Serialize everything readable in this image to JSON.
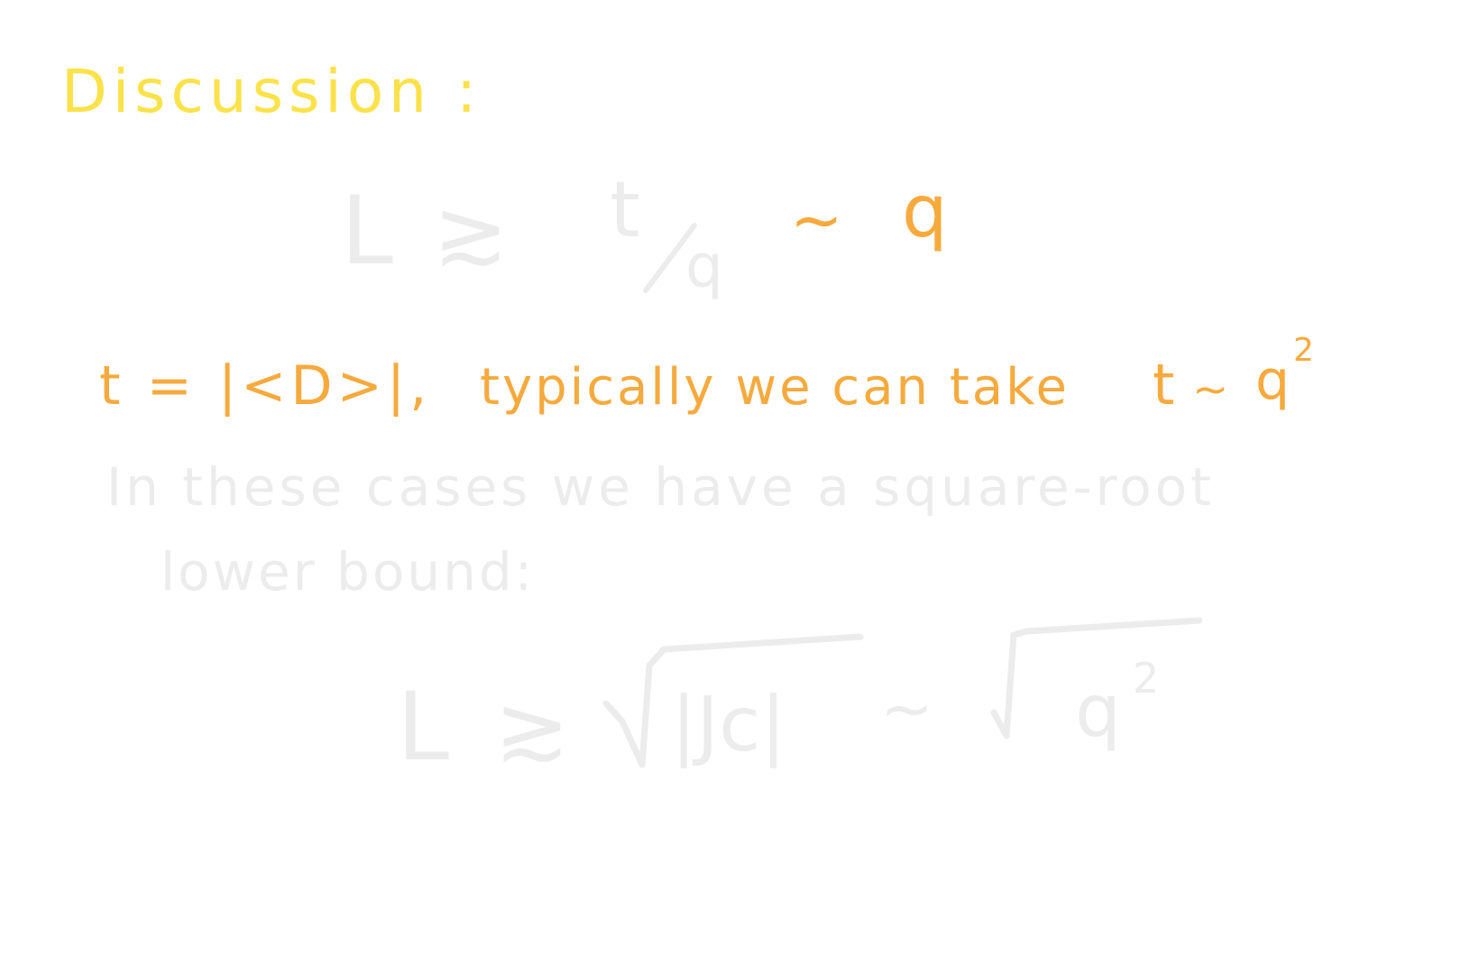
{
  "colors": {
    "heading": "#fbe24a",
    "accent": "#f6aa3d",
    "faint": "#ececec",
    "background": "#ffffff"
  },
  "heading": "Discussion :",
  "eq1": {
    "lhs": "L",
    "relation": "≳",
    "numerator": "t",
    "denominator": "q",
    "sim": "∼",
    "rhs": "q"
  },
  "line2": {
    "definition": "t = |<D>|,",
    "text": "typically we can take",
    "var": "t",
    "sim": "∼",
    "base": "q",
    "exponent": "2"
  },
  "paragraph": {
    "line1": "In these cases we have a square-root",
    "line2": "lower bound:"
  },
  "eq2": {
    "lhs": "L",
    "relation": "≳",
    "radicand1": "|Jc|",
    "sim": "∼",
    "radicand2_base": "q",
    "radicand2_exp": "2"
  }
}
